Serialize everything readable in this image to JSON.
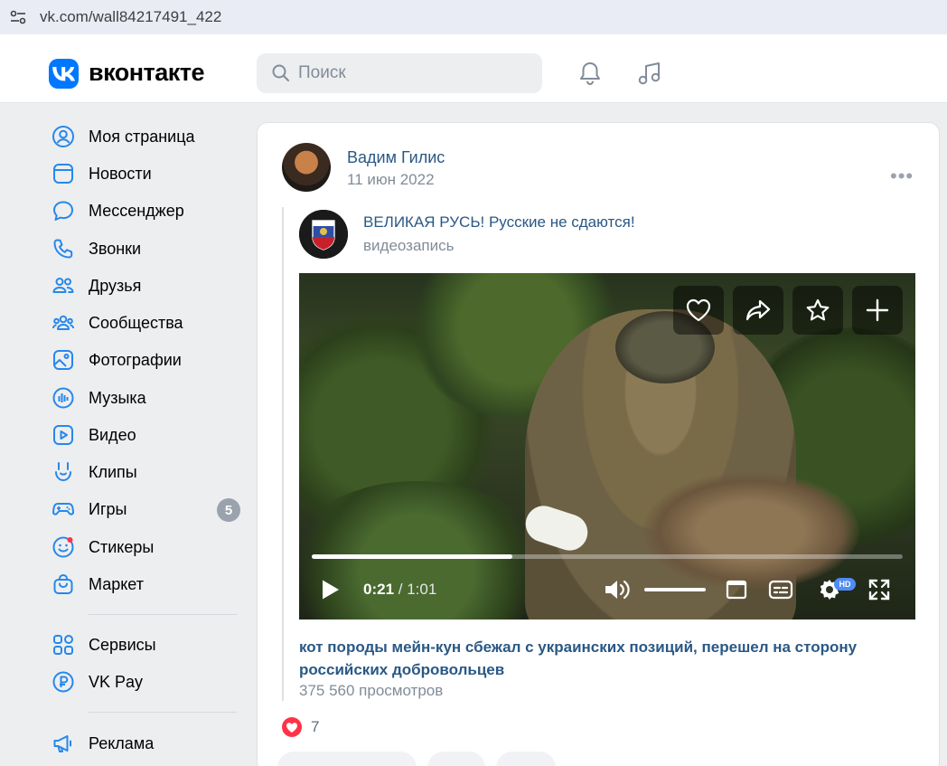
{
  "browser": {
    "url": "vk.com/wall84217491_422"
  },
  "header": {
    "logo_text": "вконтакте",
    "search_placeholder": "Поиск"
  },
  "sidebar": {
    "items": [
      {
        "label": "Моя страница",
        "icon": "user-circle-icon"
      },
      {
        "label": "Новости",
        "icon": "news-icon"
      },
      {
        "label": "Мессенджер",
        "icon": "message-icon"
      },
      {
        "label": "Звонки",
        "icon": "phone-icon"
      },
      {
        "label": "Друзья",
        "icon": "friends-icon"
      },
      {
        "label": "Сообщества",
        "icon": "communities-icon"
      },
      {
        "label": "Фотографии",
        "icon": "photos-icon"
      },
      {
        "label": "Музыка",
        "icon": "music-icon"
      },
      {
        "label": "Видео",
        "icon": "video-icon"
      },
      {
        "label": "Клипы",
        "icon": "clips-icon"
      },
      {
        "label": "Игры",
        "icon": "games-icon",
        "badge": "5"
      },
      {
        "label": "Стикеры",
        "icon": "stickers-icon"
      },
      {
        "label": "Маркет",
        "icon": "market-icon"
      }
    ],
    "secondary": [
      {
        "label": "Сервисы",
        "icon": "services-icon"
      },
      {
        "label": "VK Pay",
        "icon": "vkpay-icon"
      }
    ],
    "tertiary": [
      {
        "label": "Реклама",
        "icon": "ads-icon"
      }
    ]
  },
  "post": {
    "author": "Вадим Гилис",
    "date": "11 июн 2022",
    "repost": {
      "title": "ВЕЛИКАЯ РУСЬ! Русские не сдаются!",
      "type": "видеозапись"
    },
    "video": {
      "current_time": "0:21",
      "duration": "1:01",
      "progress": 0.34,
      "volume": 1.0,
      "quality_badge": "HD",
      "title": "кот породы мейн-кун сбежал с украинских позиций, перешел на сторону российских добровольцев",
      "views": "375 560 просмотров"
    },
    "likes": "7"
  },
  "colors": {
    "accent": "#0077ff",
    "link": "#2a5885",
    "like": "#ff3347"
  }
}
